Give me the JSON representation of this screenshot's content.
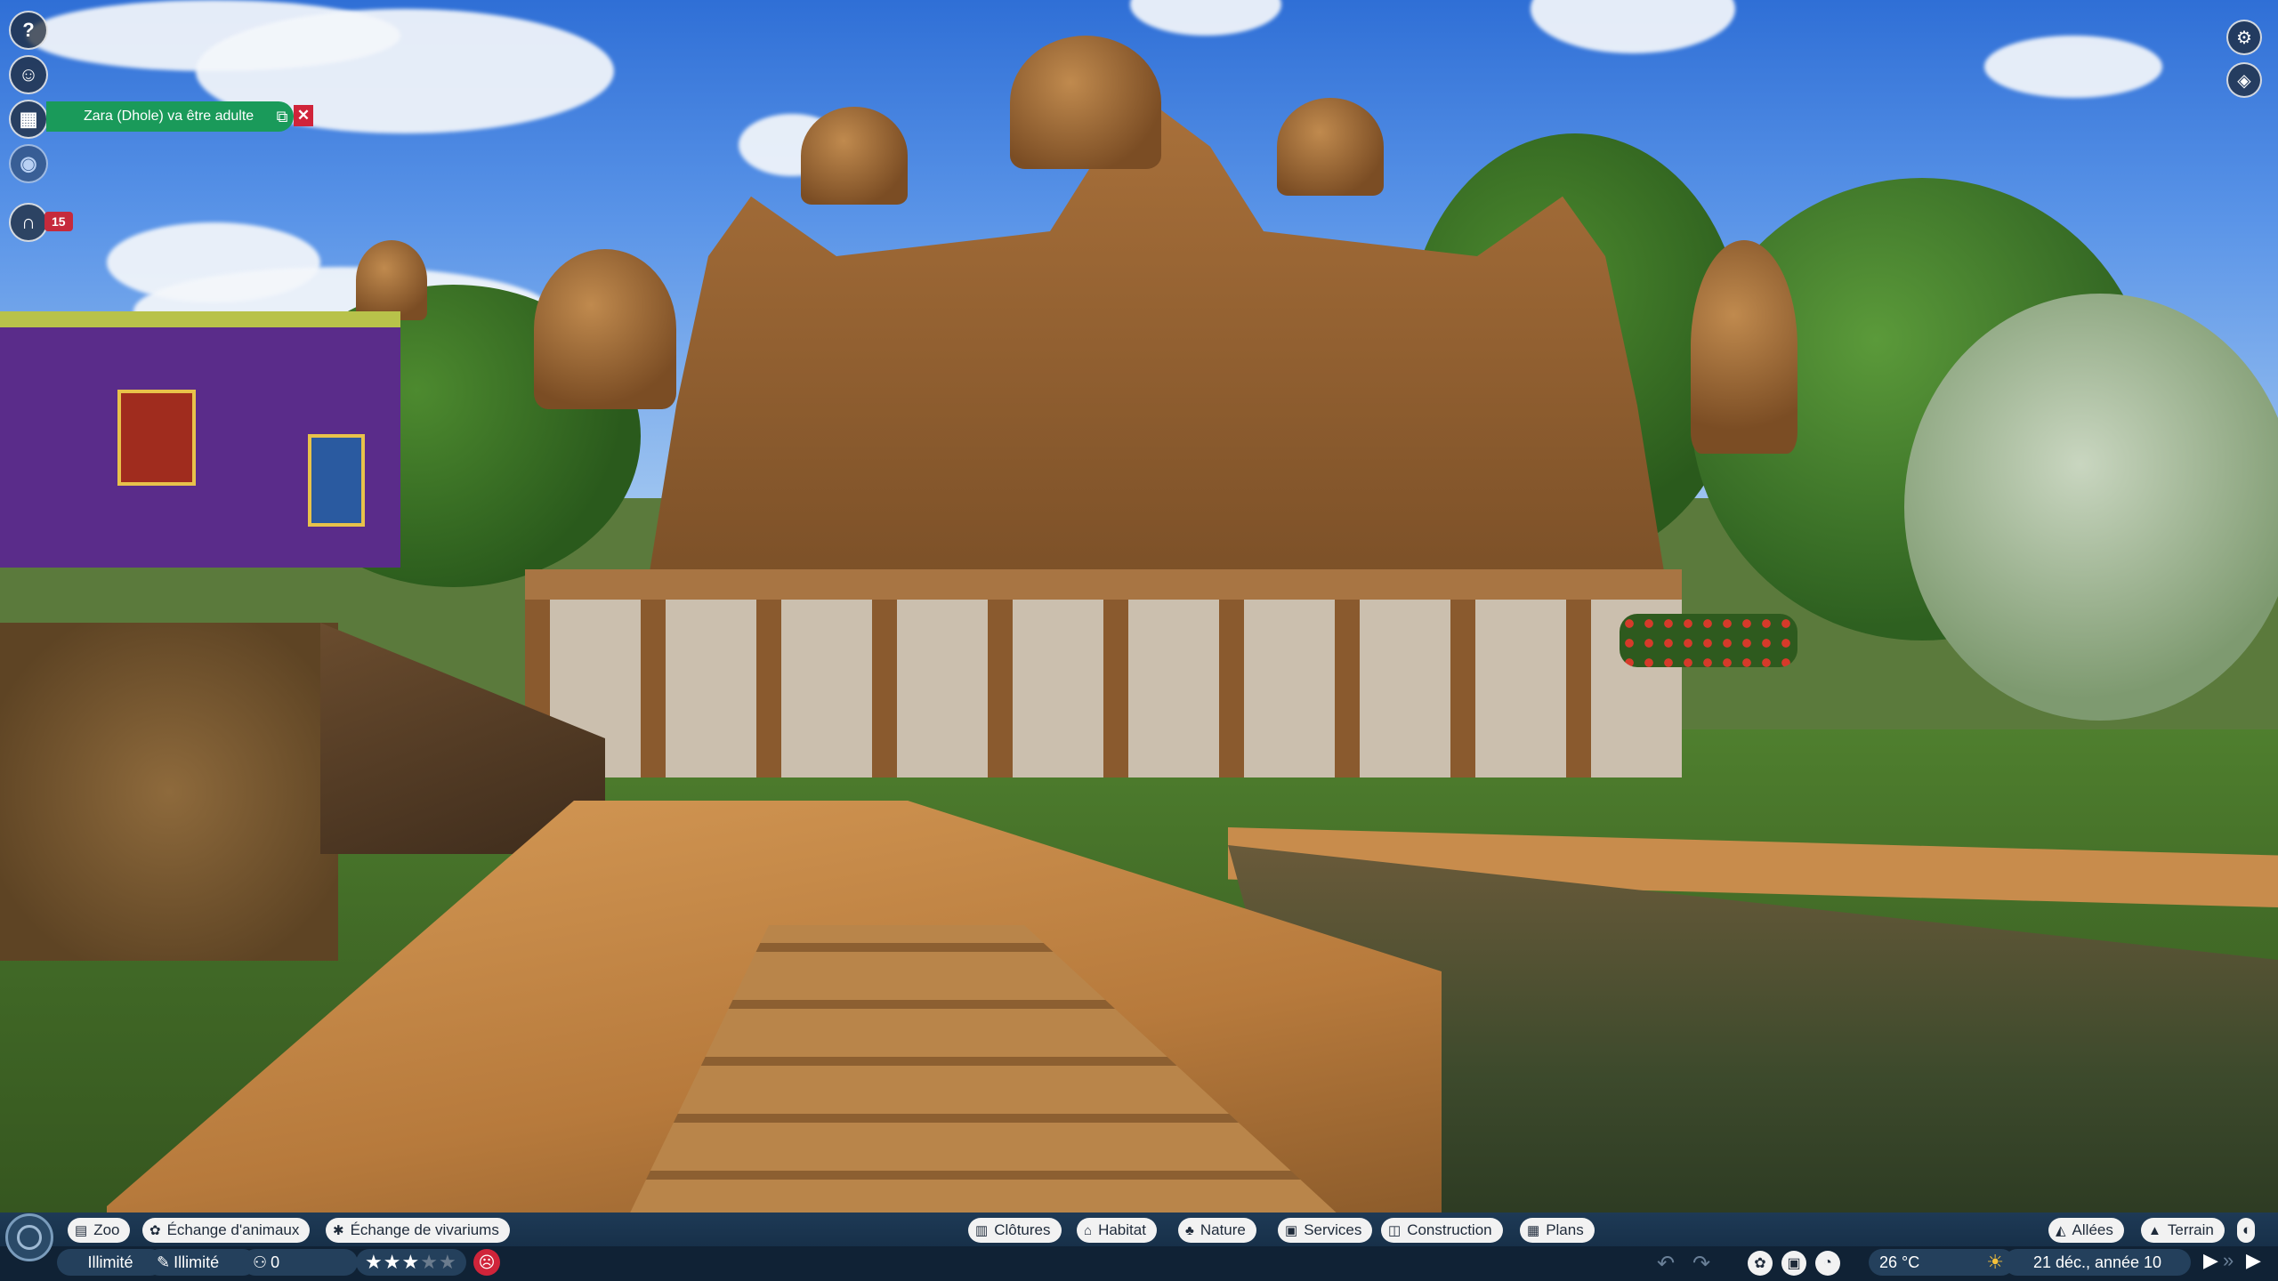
{
  "notification": {
    "text": "Zara (Dhole) va être adulte",
    "open_icon": "external-link-icon",
    "close_icon": "close-icon"
  },
  "left_toolbar": [
    {
      "name": "help-icon",
      "glyph": "?"
    },
    {
      "name": "zookeeper-icon",
      "glyph": "☺"
    },
    {
      "name": "calendar-icon",
      "glyph": "▦"
    },
    {
      "name": "visibility-icon",
      "glyph": "◉"
    },
    {
      "name": "guests-icon",
      "glyph": "∩"
    }
  ],
  "guest_badge": "15",
  "right_toolbar": [
    {
      "name": "settings-gear-icon",
      "glyph": "⚙"
    },
    {
      "name": "camera-icon",
      "glyph": "◈"
    }
  ],
  "top_bar": {
    "left_tabs": [
      {
        "label": "Zoo",
        "icon": "zoo-icon",
        "glyph": "▤"
      },
      {
        "label": "Échange d'animaux",
        "icon": "paw-icon",
        "glyph": "✿"
      },
      {
        "label": "Échange de vivariums",
        "icon": "bug-icon",
        "glyph": "✱"
      }
    ],
    "center_tabs": [
      {
        "label": "Clôtures",
        "icon": "fence-icon",
        "glyph": "▥"
      },
      {
        "label": "Habitat",
        "icon": "habitat-icon",
        "glyph": "⌂"
      },
      {
        "label": "Nature",
        "icon": "tree-icon",
        "glyph": "♣"
      },
      {
        "label": "Services",
        "icon": "shop-icon",
        "glyph": "▣"
      },
      {
        "label": "Construction",
        "icon": "construction-icon",
        "glyph": "◫"
      },
      {
        "label": "Plans",
        "icon": "blueprint-icon",
        "glyph": "▦"
      }
    ],
    "right_tabs": [
      {
        "label": "Allées",
        "icon": "path-icon",
        "glyph": "◭"
      },
      {
        "label": "Terrain",
        "icon": "terrain-icon",
        "glyph": "▲"
      }
    ],
    "end_icon": "overlay-icon"
  },
  "bottom_bar": {
    "money": "Illimité",
    "research": "Illimité",
    "guests": "0",
    "rating": {
      "value": 3,
      "max": 5
    },
    "mood_icon": "sad-face-icon",
    "temperature": "26 °C",
    "weather_icon": "sun-icon",
    "date": "21 déc., année 10"
  }
}
